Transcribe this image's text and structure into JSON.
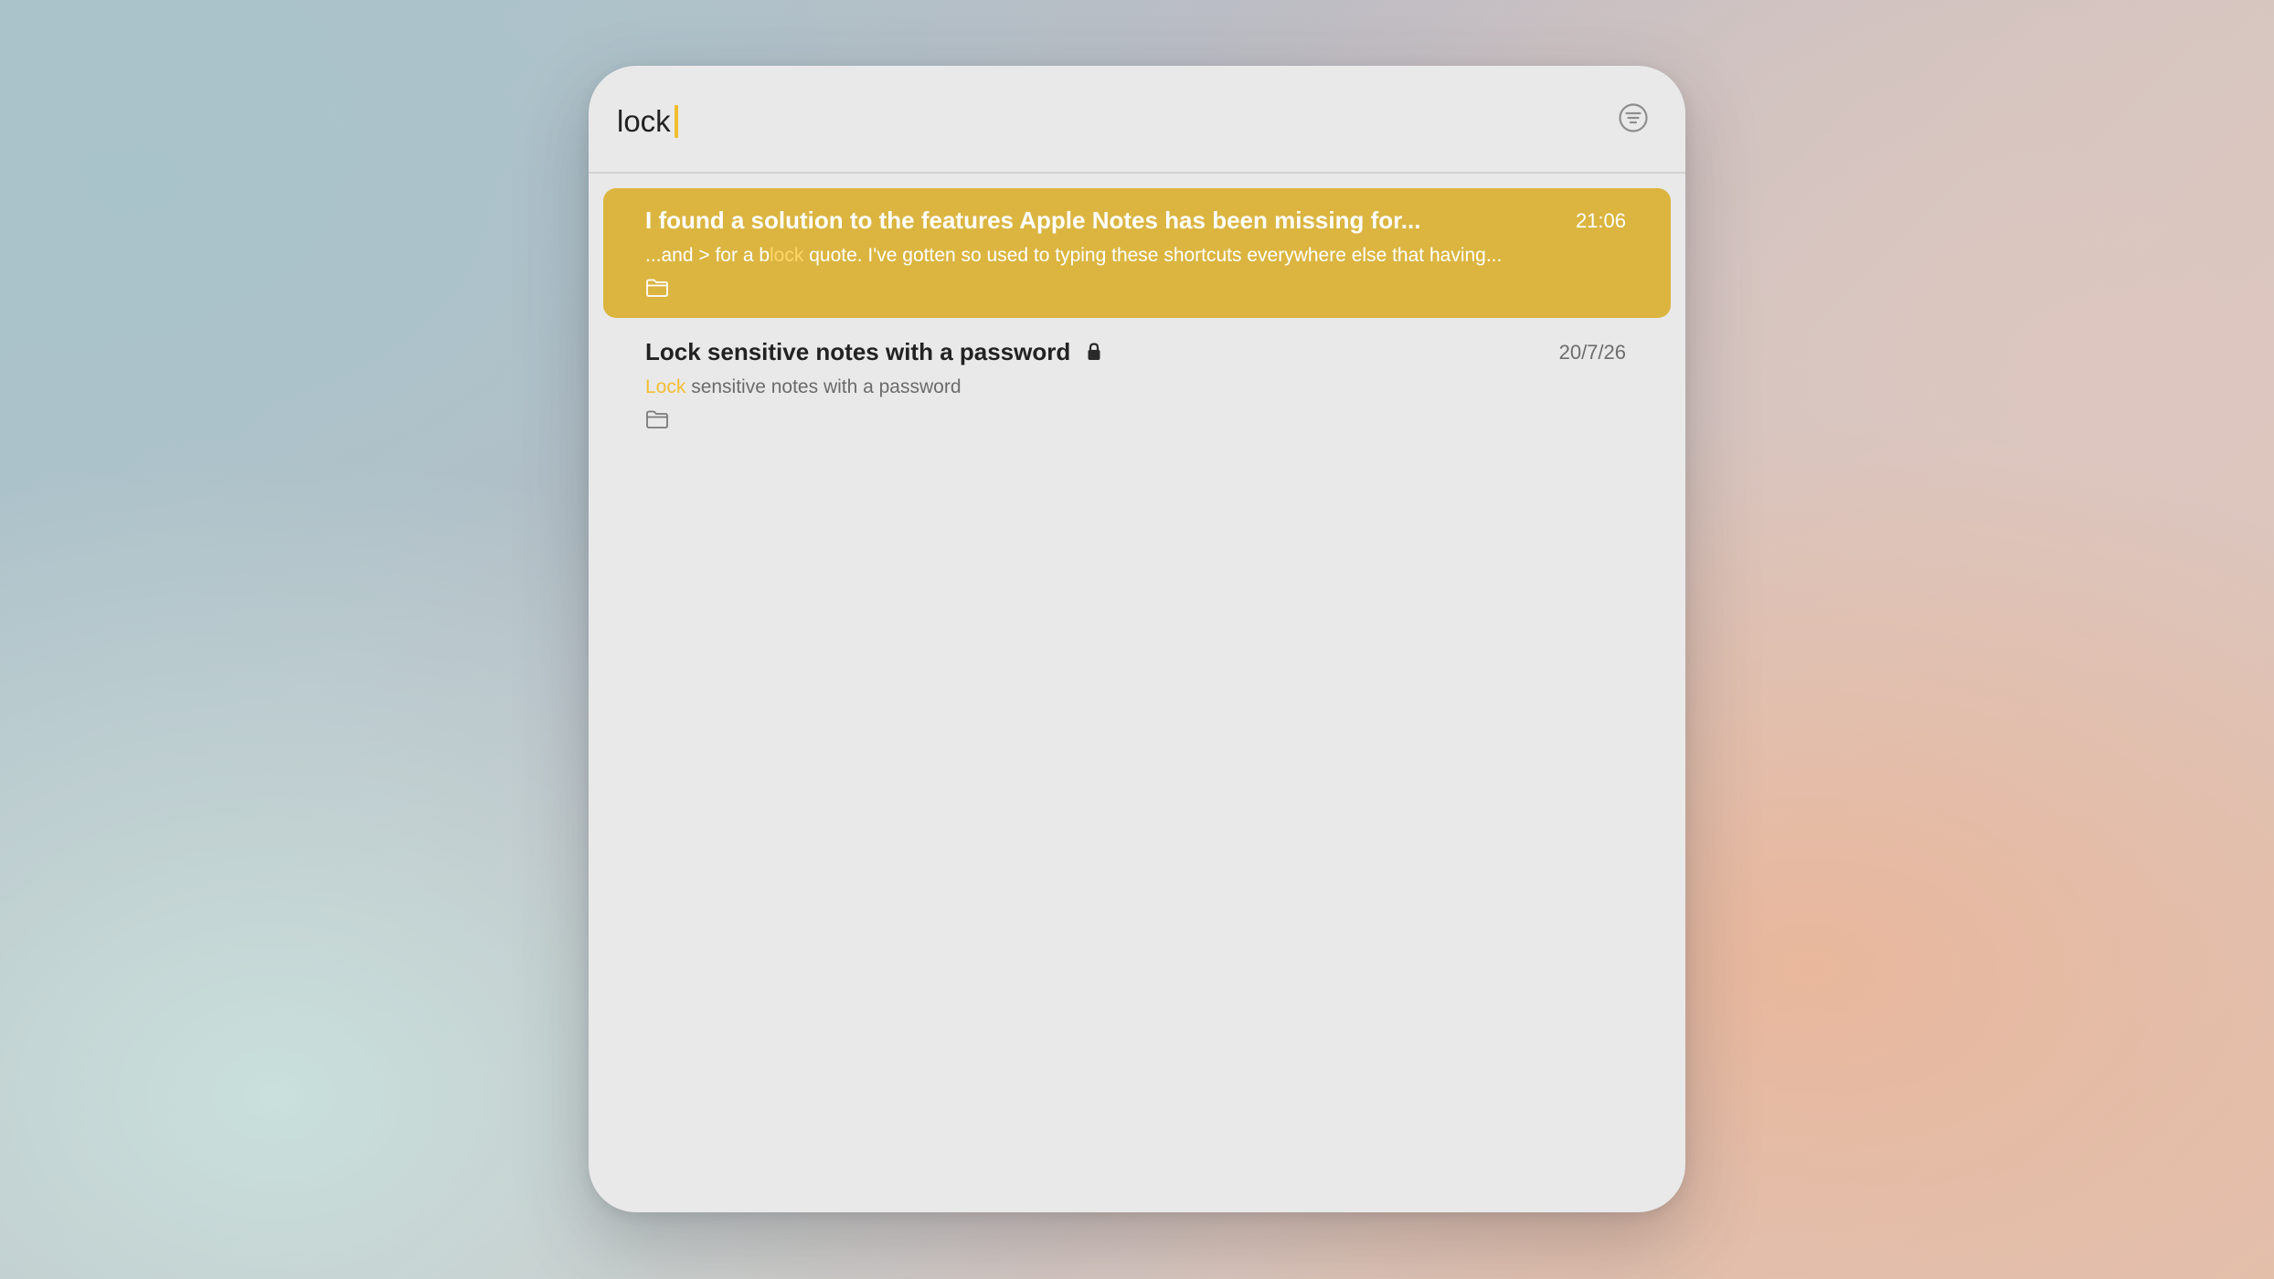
{
  "search": {
    "query": "lock"
  },
  "results": [
    {
      "title": "I found a solution to the features Apple Notes has been missing for...",
      "date": "21:06",
      "snippet_before": "...and > for a b",
      "snippet_match": "lock",
      "snippet_after": " quote. I've gotten so used to typing these shortcuts everywhere else that having...",
      "selected": true,
      "locked": false
    },
    {
      "title": "Lock sensitive notes with a password",
      "date": "20/7/26",
      "snippet_before": "",
      "snippet_match": "Lock",
      "snippet_after": " sensitive notes with a password",
      "selected": false,
      "locked": true
    }
  ],
  "icons": {
    "filter": "filter-circle-icon",
    "folder": "folder-icon",
    "lock": "lock-icon"
  },
  "colors": {
    "accent": "#f1bd2f",
    "selection": "#dbb540",
    "window_bg": "#e9e9e9"
  }
}
